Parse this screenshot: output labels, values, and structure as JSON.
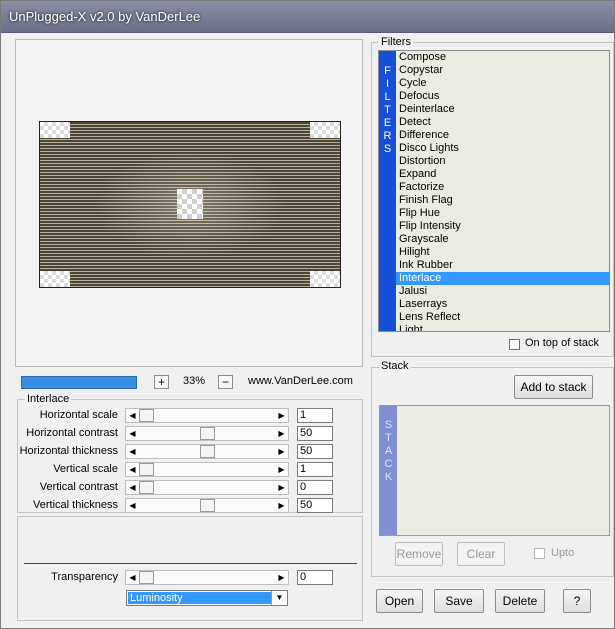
{
  "window": {
    "title": "UnPlugged-X v2.0 by VanDerLee"
  },
  "preview": {
    "zoom": "33%",
    "website": "www.VanDerLee.com",
    "zoom_plus": "+",
    "zoom_minus": "−"
  },
  "interlace": {
    "title": "Interlace",
    "params": [
      {
        "label": "Horizontal scale",
        "value": "1",
        "position": 0
      },
      {
        "label": "Horizontal contrast",
        "value": "50",
        "position": 0.5
      },
      {
        "label": "Horizontal thickness",
        "value": "50",
        "position": 0.5
      },
      {
        "label": "Vertical scale",
        "value": "1",
        "position": 0
      },
      {
        "label": "Vertical contrast",
        "value": "0",
        "position": 0
      },
      {
        "label": "Vertical thickness",
        "value": "50",
        "position": 0.5
      }
    ],
    "transparency": {
      "label": "Transparency",
      "value": "0",
      "position": 0
    },
    "blend_mode": "Luminosity"
  },
  "filters": {
    "title": "Filters",
    "vertical_label": [
      "F",
      "I",
      "L",
      "T",
      "E",
      "R",
      "S"
    ],
    "items": [
      "Compose",
      "Copystar",
      "Cycle",
      "Defocus",
      "Deinterlace",
      "Detect",
      "Difference",
      "Disco Lights",
      "Distortion",
      "Expand",
      "Factorize",
      "Finish Flag",
      "Flip Hue",
      "Flip Intensity",
      "Grayscale",
      "Hilight",
      "Ink Rubber",
      "Interlace",
      "Jalusi",
      "Laserrays",
      "Lens Reflect",
      "Light"
    ],
    "selected": "Interlace",
    "on_top_label": "On top of stack"
  },
  "stack": {
    "title": "Stack",
    "vertical_label": [
      "S",
      "T",
      "A",
      "C",
      "K"
    ],
    "add_button": "Add to stack",
    "remove_button": "Remove",
    "clear_button": "Clear",
    "upto_label": "Upto"
  },
  "footer": {
    "open": "Open",
    "save": "Save",
    "delete": "Delete",
    "help": "?"
  },
  "icons": {
    "left": "triangle-left-icon",
    "right": "triangle-right-icon",
    "dropdown": "triangle-down-icon"
  }
}
